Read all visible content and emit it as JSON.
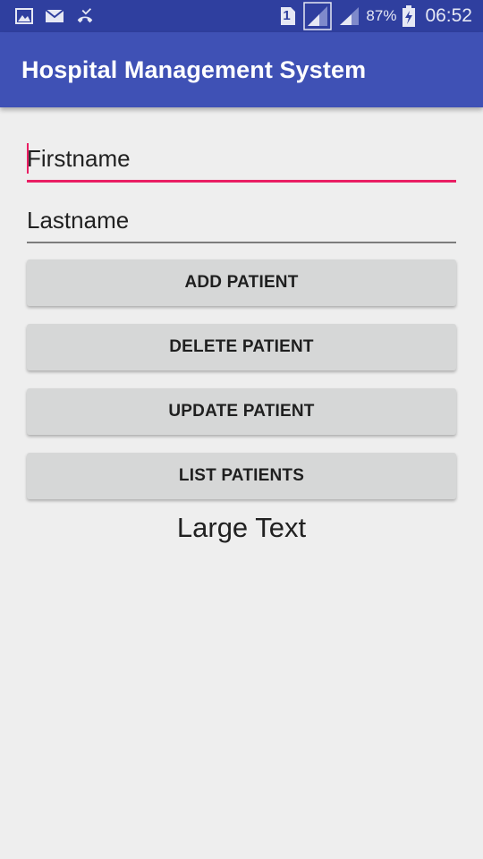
{
  "status_bar": {
    "sim_label": "1",
    "battery_percent": "87%",
    "time": "06:52",
    "icons": [
      "gallery-icon",
      "mail-icon",
      "missed-call-icon",
      "sim-icon",
      "signal-icon",
      "signal-icon",
      "battery-charging-icon"
    ]
  },
  "app_bar": {
    "title": "Hospital Management System"
  },
  "form": {
    "firstname_placeholder": "Firstname",
    "lastname_placeholder": "Lastname",
    "add_label": "ADD PATIENT",
    "delete_label": "DELETE PATIENT",
    "update_label": "UPDATE PATIENT",
    "list_label": "LIST PATIENTS",
    "large_text": "Large Text"
  },
  "colors": {
    "primary": "#3f51b5",
    "primary_dark": "#2f3f9f",
    "accent": "#e91e63",
    "button": "#d6d7d7",
    "background": "#eeeeee"
  }
}
